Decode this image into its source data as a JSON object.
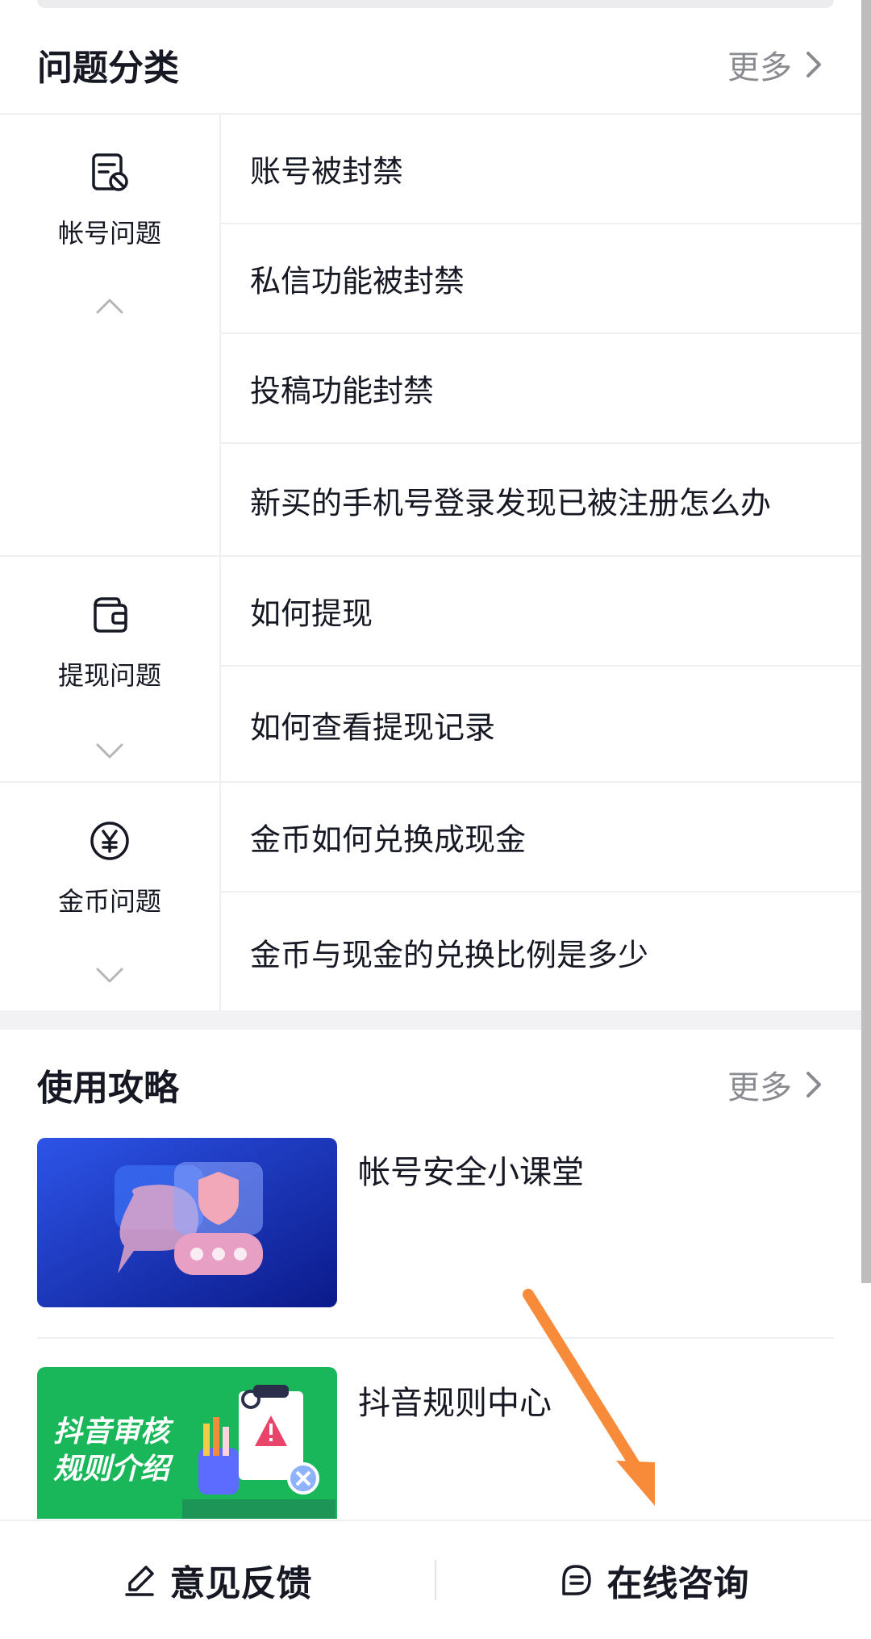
{
  "faq_section": {
    "title": "问题分类",
    "more_label": "更多"
  },
  "categories": [
    {
      "name": "帐号问题",
      "icon": "account-doc-icon",
      "expanded": true,
      "items": [
        "账号被封禁",
        "私信功能被封禁",
        "投稿功能封禁",
        "新买的手机号登录发现已被注册怎么办"
      ]
    },
    {
      "name": "提现问题",
      "icon": "wallet-icon",
      "expanded": false,
      "items": [
        "如何提现",
        "如何查看提现记录"
      ]
    },
    {
      "name": "金币问题",
      "icon": "yen-coin-icon",
      "expanded": false,
      "items": [
        "金币如何兑换成现金",
        "金币与现金的兑换比例是多少"
      ]
    }
  ],
  "guides_section": {
    "title": "使用攻略",
    "more_label": "更多",
    "items": [
      {
        "title": "帐号安全小课堂",
        "thumb_icon": "security-chat-illustration"
      },
      {
        "title": "抖音规则中心",
        "thumb_text_line1": "抖音审核",
        "thumb_text_line2": "规则介绍",
        "thumb_icon": "rules-illustration"
      }
    ]
  },
  "bottom_bar": {
    "feedback_label": "意见反馈",
    "consult_label": "在线咨询"
  },
  "colors": {
    "text": "#161823",
    "muted": "#8a8b91",
    "divider": "#efeff1",
    "arrow": "#f78b3a",
    "guide_blue": "#1a3bd1",
    "guide_green": "#19b75a"
  }
}
